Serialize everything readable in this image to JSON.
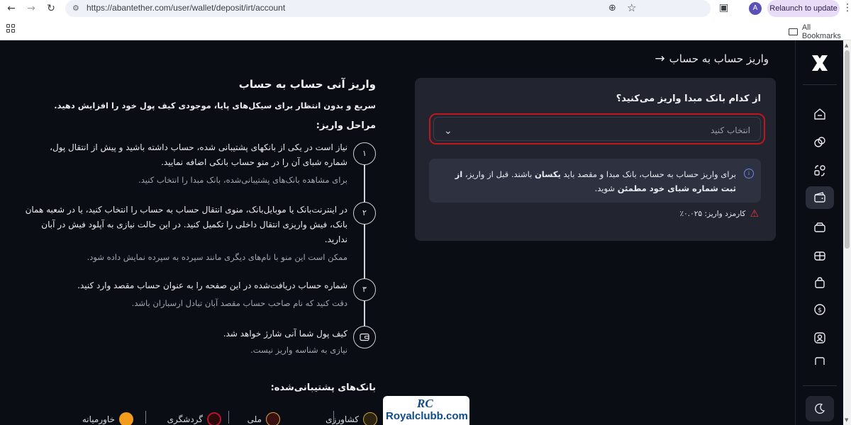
{
  "browser": {
    "url": "https://abantether.com/user/wallet/deposit/irt/account",
    "avatar_letter": "A",
    "relaunch_label": "Relaunch to update",
    "all_bookmarks": "All Bookmarks"
  },
  "page": {
    "title": "واریز حساب به حساب",
    "back_arrow": "→"
  },
  "deposit_card": {
    "question": "از کدام بانک مبدا واریز می‌کنید؟",
    "select_placeholder": "انتخاب کنید",
    "notice_part1": "برای واریز حساب به حساب، بانک مبدا و مقصد باید ",
    "notice_bold1": "یکسان",
    "notice_part2": " باشند. قبل از واریز، ",
    "notice_bold2": "از ثبت شماره شبای خود مطمئن",
    "notice_part3": " شوید.",
    "fee_text": "کارمزد واریز: ۰.۰۲۵٪"
  },
  "guide": {
    "title": "واریز آنی حساب به حساب",
    "subtitle": "سریع و بدون انتظار برای سیکل‌های پایا، موجودی کیف پول خود را افزایش دهید.",
    "steps_title": "مراحل واریز:",
    "steps": [
      {
        "num": "۱",
        "text": "نیاز است در یکی از بانکهای پشتیبانی شده، حساب داشته باشید و پیش از انتقال پول، شماره شبای آن را در منو حساب بانکی اضافه نمایید.",
        "note": "برای مشاهده بانک‌های پشتیبانی‌شده، بانک مبدا را انتخاب کنید."
      },
      {
        "num": "۲",
        "text": "در اینترنت‌بانک یا موبایل‌بانک، منوی انتقال حساب به حساب را انتخاب کنید، یا در شعبه همان بانک، فیش واریزی انتقال داخلی را تکمیل کنید. در این حالت نیازی به آپلود فیش در آبان ندارید.",
        "note": "ممکن است این منو با نام‌های دیگری مانند سپرده به سپرده نمایش داده شود."
      },
      {
        "num": "۳",
        "text": "شماره حساب دریافت‌شده در این صفحه را به عنوان حساب مقصد وارد کنید.",
        "note": "دقت کنید که نام صاحب حساب مقصد آبان تبادل ارسباران باشد."
      },
      {
        "num": "",
        "text": "کیف پول شما آنی شارژ خواهد شد.",
        "note": "نیازی به شناسه واریز نیست."
      }
    ],
    "banks_title": "بانک‌های پشتیبانی‌شده:",
    "banks": [
      "کشاورزی",
      "ملی",
      "گردشگری",
      "خاورمیانه"
    ]
  },
  "watermark": {
    "rc": "RC",
    "text": "Royalclubb.com"
  },
  "colors": {
    "background": "#0b0d14",
    "card": "#22252f",
    "select_highlight": "#c0161d",
    "info": "#6d86e8",
    "warning": "#e23a3a"
  }
}
